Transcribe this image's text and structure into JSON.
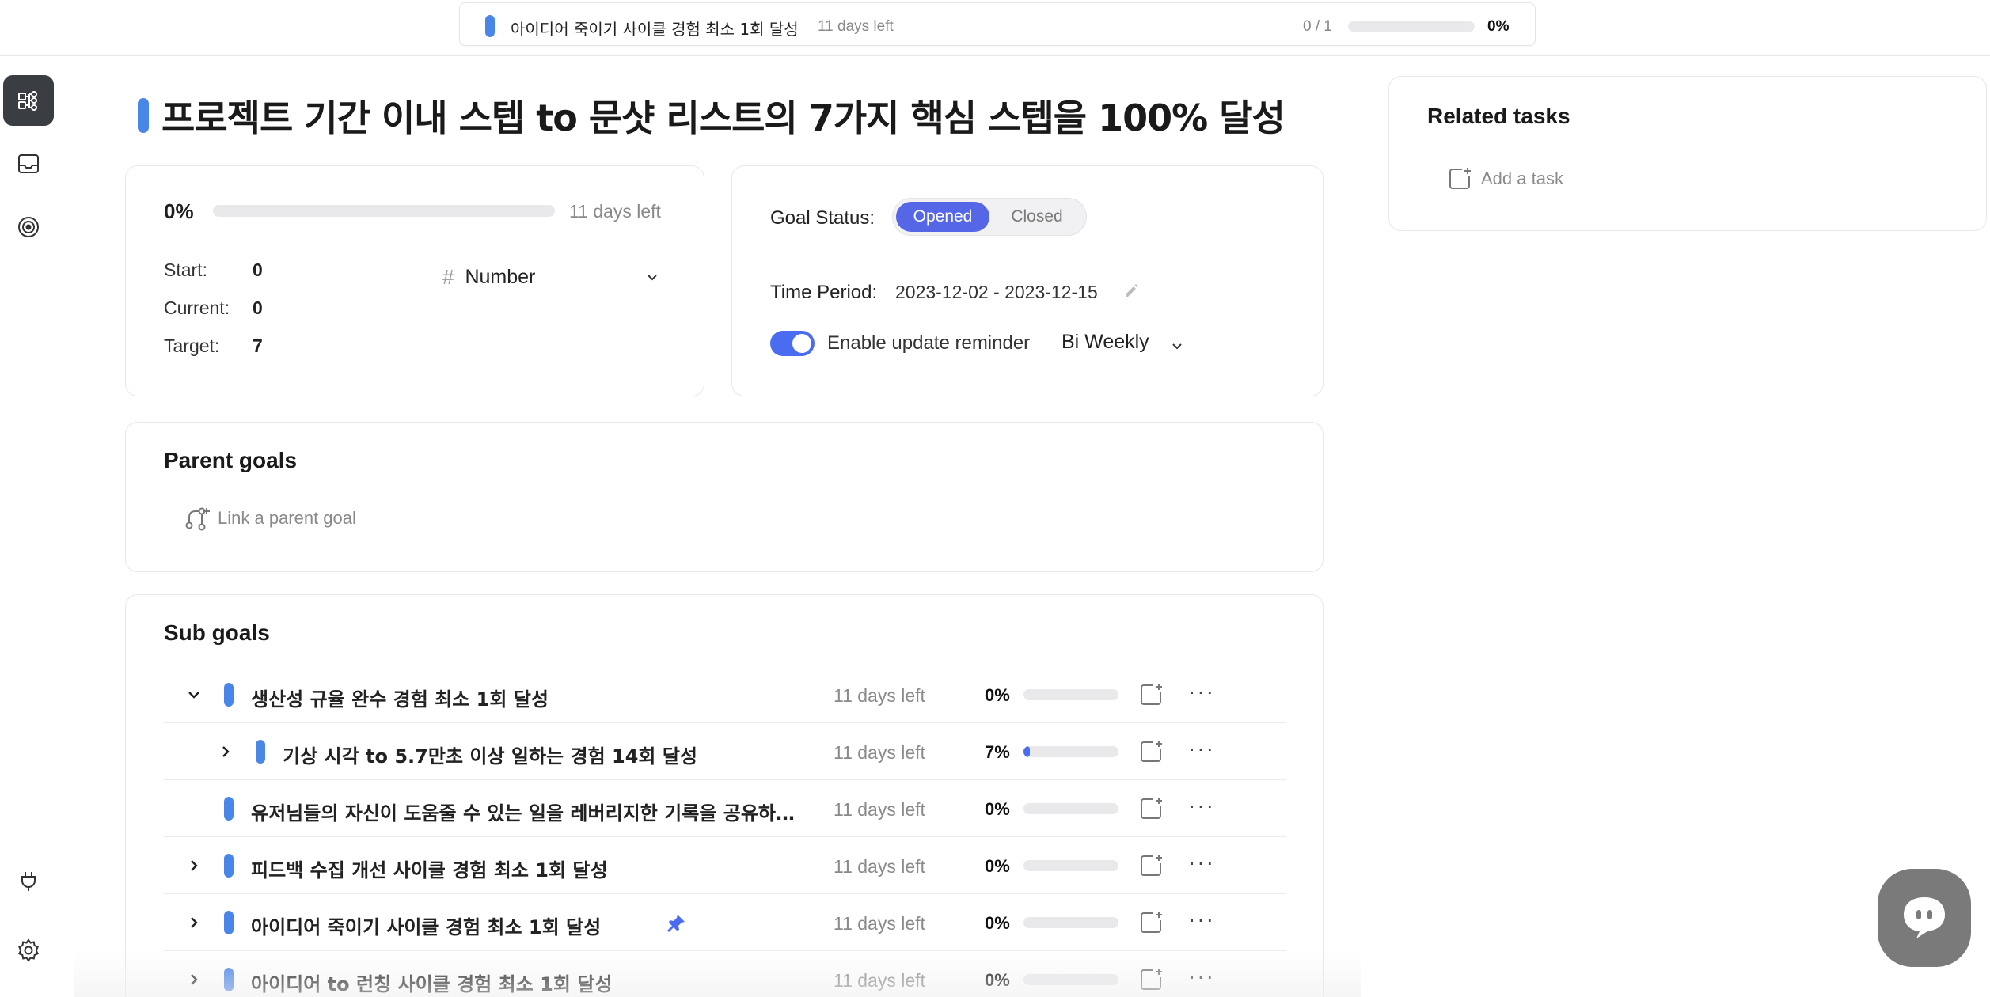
{
  "top_bar": {
    "goal_title": "아이디어 죽이기 사이클 경험 최소 1회 달성",
    "days_left": "11 days left",
    "count": "0 / 1",
    "progress_pct": "0%",
    "progress_value": 0,
    "goal_color": "#4a86e8"
  },
  "sidebar": {
    "items": [
      {
        "icon": "goal-tree-icon",
        "active": true
      },
      {
        "icon": "inbox-icon",
        "active": false
      },
      {
        "icon": "target-icon",
        "active": false
      },
      {
        "icon": "plug-icon",
        "active": false
      },
      {
        "icon": "gear-icon",
        "active": false
      }
    ]
  },
  "goal": {
    "title": "프로젝트 기간 이내 스텝 to 문샷 리스트의 7가지 핵심 스텝을 100% 달성",
    "color": "#4a86e8"
  },
  "progress": {
    "pct": "0%",
    "value": 0,
    "days_left": "11 days left",
    "start_label": "Start:",
    "start_value": "0",
    "current_label": "Current:",
    "current_value": "0",
    "target_label": "Target:",
    "target_value": "7",
    "type_icon": "#",
    "type_label": "Number"
  },
  "status": {
    "goal_status_label": "Goal Status:",
    "opened_label": "Opened",
    "closed_label": "Closed",
    "selected": "Opened",
    "time_period_label": "Time Period:",
    "time_period_value": "2023-12-02 - 2023-12-15",
    "reminder_label": "Enable update reminder",
    "reminder_enabled": true,
    "frequency": "Bi Weekly",
    "accent": "#5566e6"
  },
  "parent_goals": {
    "heading": "Parent goals",
    "link_label": "Link a parent goal"
  },
  "sub_goals": {
    "heading": "Sub goals",
    "rows": [
      {
        "name": "생산성 규율 완수 경험 최소 1회 달성",
        "days_left": "11 days left",
        "pct": "0%",
        "value": 0,
        "expand": "expanded",
        "depth": 0,
        "pinned": false
      },
      {
        "name": "기상 시각 to 5.7만초 이상 일하는 경험 14회 달성",
        "days_left": "11 days left",
        "pct": "7%",
        "value": 7,
        "expand": "collapsed",
        "depth": 1,
        "pinned": false
      },
      {
        "name": "유저님들의 자신이 도움줄 수 있는 일을 레버리지한 기록을 공유하…",
        "days_left": "11 days left",
        "pct": "0%",
        "value": 0,
        "expand": "none",
        "depth": 0,
        "pinned": false
      },
      {
        "name": "피드백 수집 개선 사이클 경험 최소 1회 달성",
        "days_left": "11 days left",
        "pct": "0%",
        "value": 0,
        "expand": "collapsed",
        "depth": 0,
        "pinned": false
      },
      {
        "name": "아이디어 죽이기 사이클 경험 최소 1회 달성",
        "days_left": "11 days left",
        "pct": "0%",
        "value": 0,
        "expand": "collapsed",
        "depth": 0,
        "pinned": true
      },
      {
        "name": "아이디어 to 런칭 사이클 경험 최소 1회 달성",
        "days_left": "11 days left",
        "pct": "0%",
        "value": 0,
        "expand": "collapsed",
        "depth": 0,
        "pinned": false
      }
    ],
    "more_label": "···"
  },
  "related_tasks": {
    "heading": "Related tasks",
    "add_label": "Add a task"
  },
  "chat": {
    "icon": "chat-bubble-icon"
  }
}
